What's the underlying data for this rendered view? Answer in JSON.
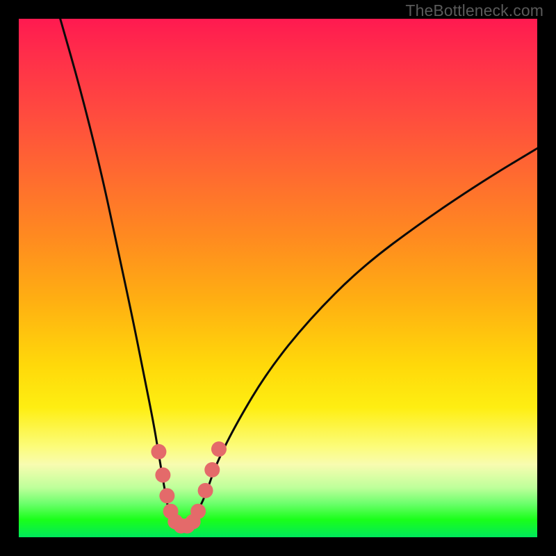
{
  "watermark": "TheBottleneck.com",
  "chart_data": {
    "type": "line",
    "title": "",
    "xlabel": "",
    "ylabel": "",
    "xlim": [
      0,
      100
    ],
    "ylim": [
      0,
      100
    ],
    "series": [
      {
        "name": "bottleneck-curve",
        "x": [
          8,
          12,
          16,
          19,
          22,
          24,
          26,
          27,
          28,
          29,
          30,
          31,
          32,
          33,
          34,
          36,
          38,
          42,
          48,
          56,
          66,
          78,
          90,
          100
        ],
        "y": [
          100,
          86,
          70,
          56,
          42,
          32,
          22,
          16,
          10,
          4.5,
          2.5,
          2,
          2,
          2.5,
          4,
          8,
          14,
          22,
          32,
          42,
          52,
          61,
          69,
          75
        ]
      }
    ],
    "markers": {
      "name": "highlight-dots",
      "color": "#e46a6a",
      "points": [
        {
          "x": 27.0,
          "y": 16.5
        },
        {
          "x": 27.8,
          "y": 12.0
        },
        {
          "x": 28.6,
          "y": 8.0
        },
        {
          "x": 29.3,
          "y": 5.0
        },
        {
          "x": 30.2,
          "y": 3.0
        },
        {
          "x": 31.3,
          "y": 2.2
        },
        {
          "x": 32.5,
          "y": 2.2
        },
        {
          "x": 33.6,
          "y": 3.0
        },
        {
          "x": 34.6,
          "y": 5.0
        },
        {
          "x": 36.0,
          "y": 9.0
        },
        {
          "x": 37.3,
          "y": 13.0
        },
        {
          "x": 38.6,
          "y": 17.0
        }
      ]
    },
    "colors": {
      "curve_stroke": "#0a0a0a",
      "marker_fill": "#e46a6a",
      "background_top": "#ff1a50",
      "background_bottom": "#00e85c"
    }
  }
}
